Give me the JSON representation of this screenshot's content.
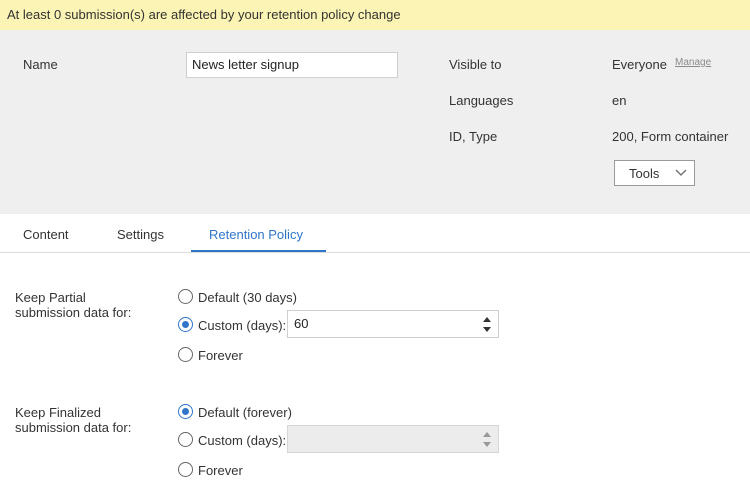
{
  "banner": {
    "text": "At least 0 submission(s) are affected by your retention policy change"
  },
  "header": {
    "name_label": "Name",
    "name_value": "News letter signup",
    "visible_label": "Visible to",
    "visible_value": "Everyone",
    "manage_link": "Manage",
    "languages_label": "Languages",
    "languages_value": "en",
    "id_type_label": "ID, Type",
    "id_type_value": "200, Form container",
    "tools_label": "Tools"
  },
  "tabs": [
    {
      "label": "Content",
      "active": false
    },
    {
      "label": "Settings",
      "active": false
    },
    {
      "label": "Retention Policy",
      "active": true
    }
  ],
  "partial": {
    "label_line1": "Keep Partial",
    "label_line2": "submission data for:",
    "opt_default": "Default (30 days)",
    "opt_custom": "Custom (days):",
    "custom_value": "60",
    "opt_forever": "Forever",
    "selected": "custom"
  },
  "finalized": {
    "label_line1": "Keep Finalized",
    "label_line2": "submission data for:",
    "opt_default": "Default (forever)",
    "opt_custom": "Custom (days):",
    "custom_value": "",
    "opt_forever": "Forever",
    "selected": "default"
  },
  "colors": {
    "accent": "#2f76c9",
    "banner_bg": "#fbf4b4",
    "header_bg": "#efefef"
  }
}
